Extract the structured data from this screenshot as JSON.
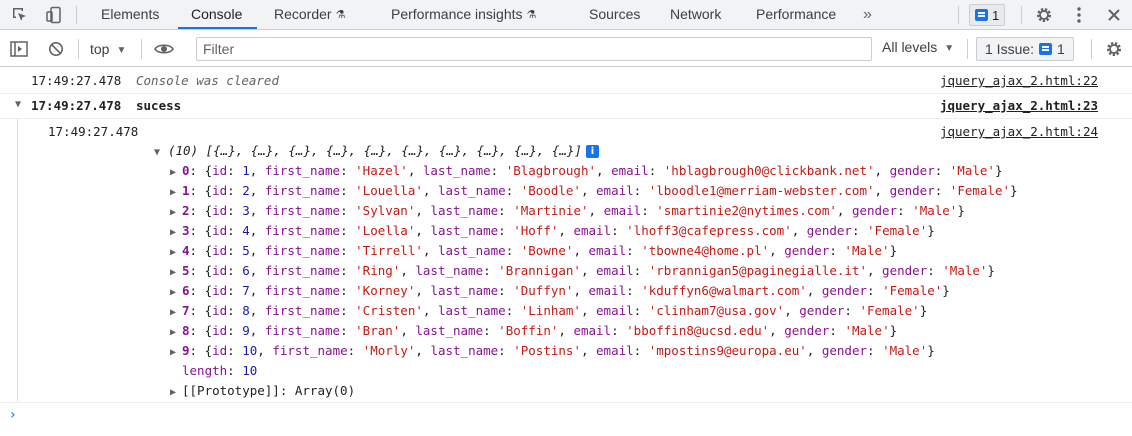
{
  "tabbar": {
    "icons": {
      "inspect": "inspect-element-icon",
      "device": "device-toolbar-icon"
    },
    "tabs": [
      {
        "label": "Elements"
      },
      {
        "label": "Console"
      },
      {
        "label": "Recorder"
      },
      {
        "label": "Performance insights"
      },
      {
        "label": "Sources"
      },
      {
        "label": "Network"
      },
      {
        "label": "Performance"
      }
    ],
    "more_tabs": "»",
    "issue_count": "1",
    "settings_icon": "gear-icon",
    "menu_icon": "kebab-menu-icon",
    "close_icon": "close-icon"
  },
  "toolbar": {
    "context": "top",
    "filter_placeholder": "Filter",
    "levels": "All levels",
    "issues_label": "1 Issue:",
    "issues_count": "1"
  },
  "console": {
    "line1": {
      "time": "17:49:27.478",
      "text": "Console was cleared",
      "source": "jquery_ajax_2.html:22"
    },
    "line2": {
      "time": "17:49:27.478",
      "text": "sucess",
      "source": "jquery_ajax_2.html:23"
    },
    "line3": {
      "time": "17:49:27.478",
      "source": "jquery_ajax_2.html:24"
    },
    "array_summary": "(10) [{…}, {…}, {…}, {…}, {…}, {…}, {…}, {…}, {…}, {…}]",
    "rows": [
      {
        "idx": "0",
        "id": "1",
        "first_name": "'Hazel'",
        "last_name": "'Blagbrough'",
        "email": "'hblagbrough0@clickbank.net'",
        "gender": "'Male'"
      },
      {
        "idx": "1",
        "id": "2",
        "first_name": "'Louella'",
        "last_name": "'Boodle'",
        "email": "'lboodle1@merriam-webster.com'",
        "gender": "'Female'"
      },
      {
        "idx": "2",
        "id": "3",
        "first_name": "'Sylvan'",
        "last_name": "'Martinie'",
        "email": "'smartinie2@nytimes.com'",
        "gender": "'Male'"
      },
      {
        "idx": "3",
        "id": "4",
        "first_name": "'Loella'",
        "last_name": "'Hoff'",
        "email": "'lhoff3@cafepress.com'",
        "gender": "'Female'"
      },
      {
        "idx": "4",
        "id": "5",
        "first_name": "'Tirrell'",
        "last_name": "'Bowne'",
        "email": "'tbowne4@home.pl'",
        "gender": "'Male'"
      },
      {
        "idx": "5",
        "id": "6",
        "first_name": "'Ring'",
        "last_name": "'Brannigan'",
        "email": "'rbrannigan5@paginegialle.it'",
        "gender": "'Male'"
      },
      {
        "idx": "6",
        "id": "7",
        "first_name": "'Korney'",
        "last_name": "'Duffyn'",
        "email": "'kduffyn6@walmart.com'",
        "gender": "'Female'"
      },
      {
        "idx": "7",
        "id": "8",
        "first_name": "'Cristen'",
        "last_name": "'Linham'",
        "email": "'clinham7@usa.gov'",
        "gender": "'Female'"
      },
      {
        "idx": "8",
        "id": "9",
        "first_name": "'Bran'",
        "last_name": "'Boffin'",
        "email": "'bboffin8@ucsd.edu'",
        "gender": "'Male'"
      },
      {
        "idx": "9",
        "id": "10",
        "first_name": "'Morly'",
        "last_name": "'Postins'",
        "email": "'mpostins9@europa.eu'",
        "gender": "'Male'"
      }
    ],
    "length_key": "length",
    "length_value": "10",
    "prototype": "[[Prototype]]: Array(0)",
    "prompt": "›"
  },
  "colors": {
    "accent": "#1a73e8",
    "key": "#881391",
    "string": "#c41a16",
    "number": "#1a1aa6"
  }
}
